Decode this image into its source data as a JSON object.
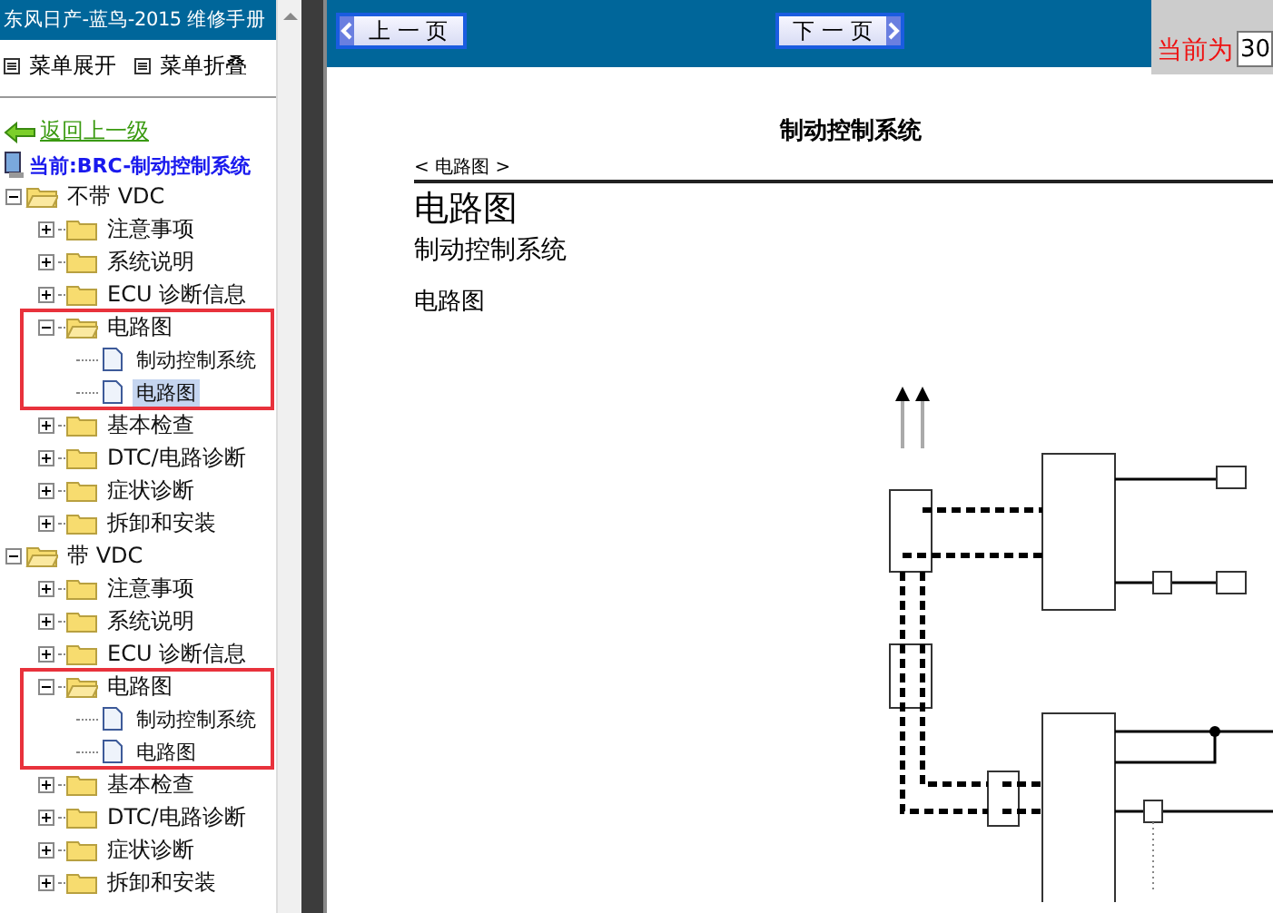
{
  "sidebar": {
    "title": "东风日产-蓝鸟-2015 维修手册",
    "menu": [
      {
        "label": "菜单展开"
      },
      {
        "label": "菜单折叠"
      }
    ],
    "back_link": "返回上一级",
    "current": "当前:BRC-制动控制系统",
    "tree": [
      {
        "label": "不带 VDC",
        "expanded": true,
        "children": [
          {
            "label": "注意事项",
            "expanded": false,
            "highlighted": false
          },
          {
            "label": "系统说明",
            "expanded": false,
            "highlighted": false
          },
          {
            "label": "ECU 诊断信息",
            "expanded": false,
            "highlighted": false
          },
          {
            "label": "电路图",
            "expanded": true,
            "highlighted": true,
            "children": [
              {
                "label": "制动控制系统",
                "selected": false
              },
              {
                "label": "电路图",
                "selected": true
              }
            ]
          },
          {
            "label": "基本检查",
            "expanded": false,
            "highlighted": false
          },
          {
            "label": "DTC/电路诊断",
            "expanded": false,
            "highlighted": false
          },
          {
            "label": "症状诊断",
            "expanded": false,
            "highlighted": false
          },
          {
            "label": "拆卸和安装",
            "expanded": false,
            "highlighted": false
          }
        ]
      },
      {
        "label": "带 VDC",
        "expanded": true,
        "children": [
          {
            "label": "注意事项",
            "expanded": false,
            "highlighted": false
          },
          {
            "label": "系统说明",
            "expanded": false,
            "highlighted": false
          },
          {
            "label": "ECU 诊断信息",
            "expanded": false,
            "highlighted": false
          },
          {
            "label": "电路图",
            "expanded": true,
            "highlighted": true,
            "children": [
              {
                "label": "制动控制系统",
                "selected": false
              },
              {
                "label": "电路图",
                "selected": false
              }
            ]
          },
          {
            "label": "基本检查",
            "expanded": false,
            "highlighted": false
          },
          {
            "label": "DTC/电路诊断",
            "expanded": false,
            "highlighted": false
          },
          {
            "label": "症状诊断",
            "expanded": false,
            "highlighted": false
          },
          {
            "label": "拆卸和安装",
            "expanded": false,
            "highlighted": false
          }
        ]
      }
    ]
  },
  "toolbar": {
    "prev_button": "上 一 页",
    "next_button": "下 一 页",
    "page_label": "当前为",
    "page_value": "30"
  },
  "document": {
    "header": "制动控制系统",
    "breadcrumb": "< 电路图 >",
    "title": "电路图",
    "subtitle": "制动控制系统",
    "section": "电路图"
  }
}
